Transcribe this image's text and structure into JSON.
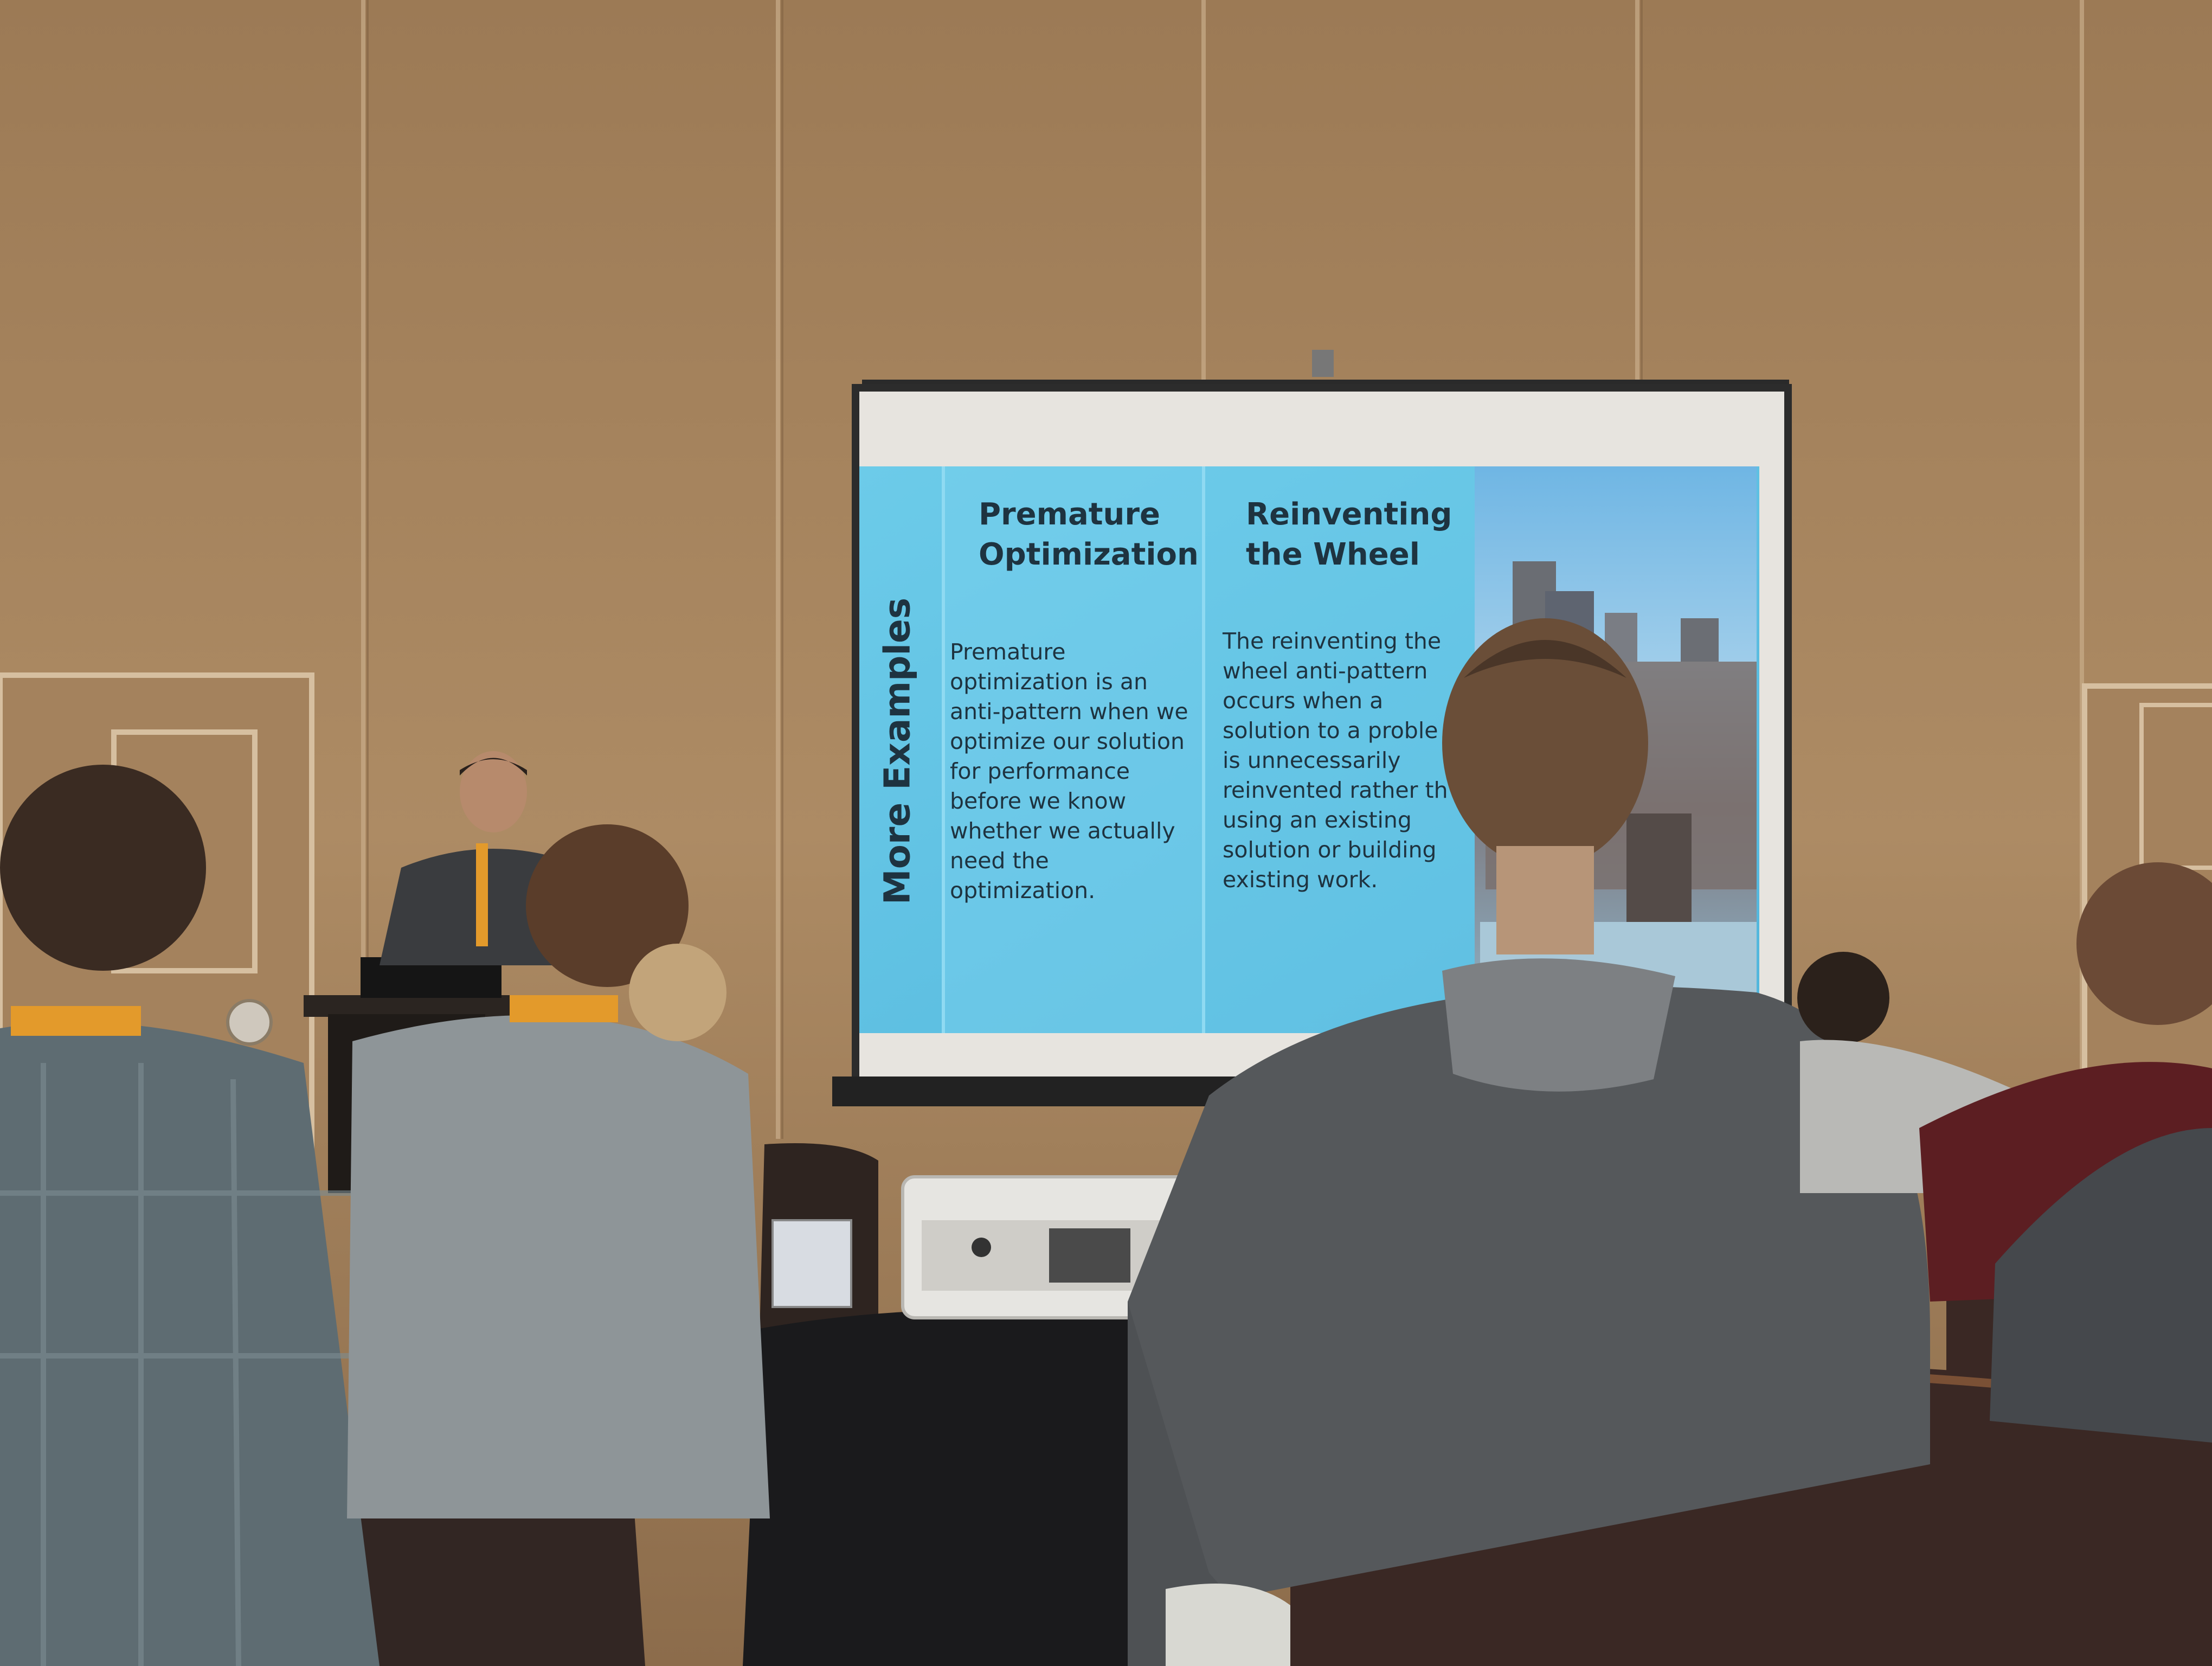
{
  "slide": {
    "side_title": "More Examples",
    "columns": [
      {
        "title": "Premature Optimization",
        "body": "Premature optimization is an anti-pattern when we optimize our solution for performance before we know whether we actually need the optimization."
      },
      {
        "title": "Reinventing the Wheel",
        "body": "The reinventing the wheel anti-pattern occurs when a solution to a proble is unnecessarily reinvented rather th using an existing solution or building existing work."
      }
    ]
  },
  "colors": {
    "wall": "#a8855f",
    "slide_bg": "#5fc3e3",
    "slide_text": "#1e3340"
  }
}
